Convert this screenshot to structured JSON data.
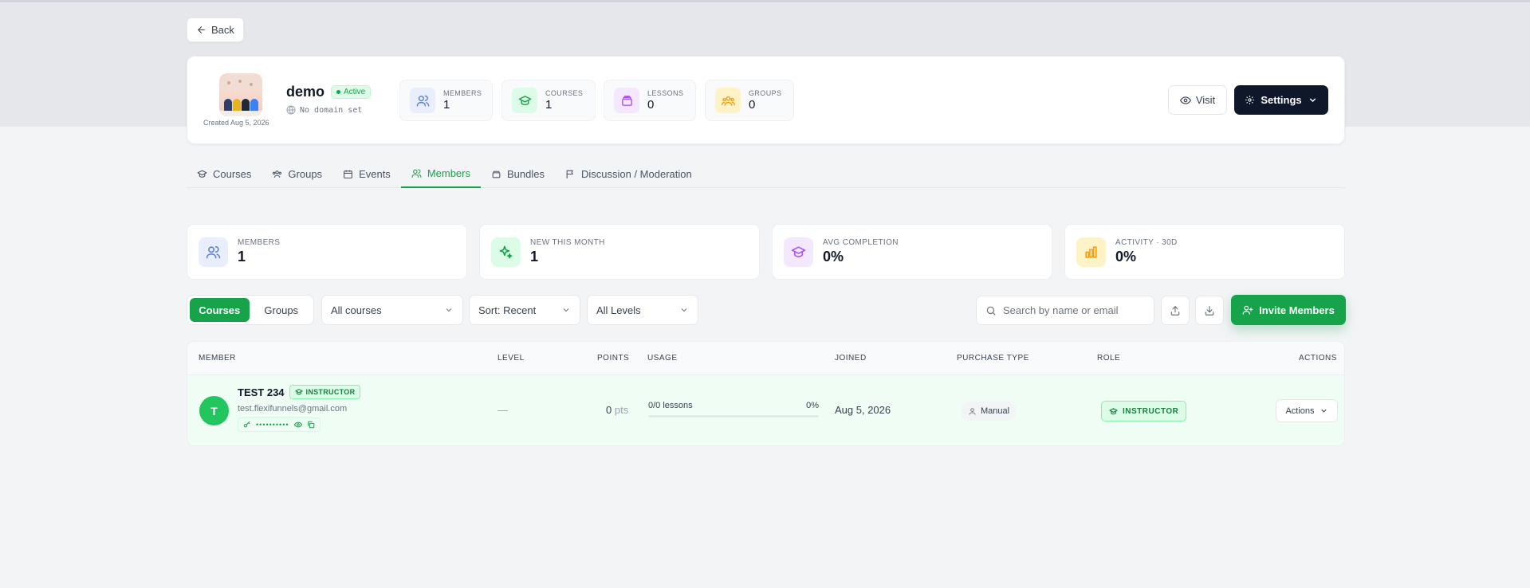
{
  "back_label": "Back",
  "header": {
    "created": "Created Aug 5, 2026",
    "title": "demo",
    "status": "Active",
    "domain": "No domain set",
    "stats": [
      {
        "label": "MEMBERS",
        "value": "1",
        "icon": "users-icon",
        "color": "#5b7fd6",
        "bg": "#e8eefc"
      },
      {
        "label": "COURSES",
        "value": "1",
        "icon": "graduation-cap-icon",
        "color": "#16a34a",
        "bg": "#dcfce7"
      },
      {
        "label": "LESSONS",
        "value": "0",
        "icon": "layers-icon",
        "color": "#a855f7",
        "bg": "#f3e8ff"
      },
      {
        "label": "GROUPS",
        "value": "0",
        "icon": "group-icon",
        "color": "#f59e0b",
        "bg": "#fef3c7"
      }
    ],
    "visit_label": "Visit",
    "settings_label": "Settings"
  },
  "tabs": [
    {
      "label": "Courses",
      "icon": "graduation-cap-icon",
      "active": false
    },
    {
      "label": "Groups",
      "icon": "group-icon",
      "active": false
    },
    {
      "label": "Events",
      "icon": "calendar-icon",
      "active": false
    },
    {
      "label": "Members",
      "icon": "users-icon",
      "active": true
    },
    {
      "label": "Bundles",
      "icon": "bundle-icon",
      "active": false
    },
    {
      "label": "Discussion / Moderation",
      "icon": "flag-icon",
      "active": false
    }
  ],
  "stat_cards": [
    {
      "label": "MEMBERS",
      "value": "1",
      "icon": "users-icon",
      "color": "#5b7fd6",
      "bg": "#e8eefc"
    },
    {
      "label": "NEW THIS MONTH",
      "value": "1",
      "icon": "sparkles-icon",
      "color": "#16a34a",
      "bg": "#dcfce7"
    },
    {
      "label": "AVG COMPLETION",
      "value": "0%",
      "icon": "graduation-cap-icon",
      "color": "#a855f7",
      "bg": "#f3e8ff"
    },
    {
      "label": "ACTIVITY · 30D",
      "value": "0%",
      "icon": "bar-chart-icon",
      "color": "#f59e0b",
      "bg": "#fef3c7"
    }
  ],
  "filters": {
    "segment": [
      "Courses",
      "Groups"
    ],
    "course_select": "All courses",
    "sort_select": "Sort: Recent",
    "level_select": "All Levels",
    "search_placeholder": "Search by name or email",
    "invite_label": "Invite Members"
  },
  "table": {
    "columns": [
      "MEMBER",
      "LEVEL",
      "POINTS",
      "USAGE",
      "JOINED",
      "PURCHASE TYPE",
      "ROLE",
      "ACTIONS"
    ],
    "rows": [
      {
        "initial": "T",
        "name": "TEST 234",
        "badge": "INSTRUCTOR",
        "email": "test.flexifunnels@gmail.com",
        "password_mask": "••••••••••",
        "level": "—",
        "points": "0",
        "points_unit": "pts",
        "usage_text": "0/0 lessons",
        "usage_pct": "0%",
        "usage_fraction": 0,
        "joined": "Aug 5, 2026",
        "purchase_type": "Manual",
        "role": "INSTRUCTOR",
        "actions_label": "Actions"
      }
    ]
  }
}
